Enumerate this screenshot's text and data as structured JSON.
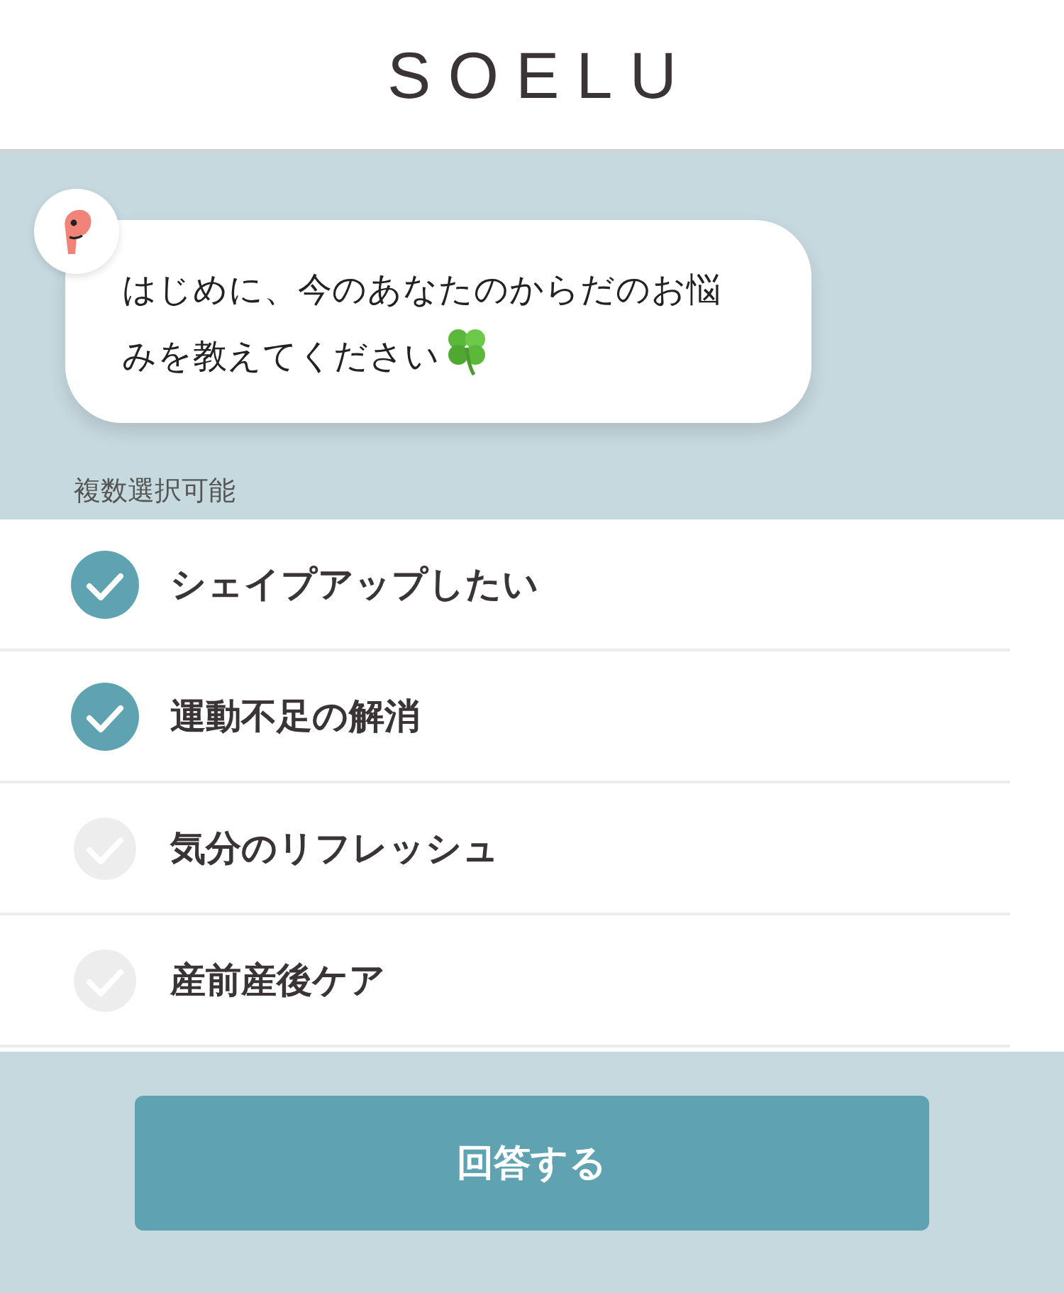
{
  "header": {
    "logo": "SOELU"
  },
  "message": {
    "text": "はじめに、今のあなたのからだのお悩みを教えてください"
  },
  "hint": "複数選択可能",
  "options": [
    {
      "label": "シェイプアップしたい",
      "checked": true
    },
    {
      "label": "運動不足の解消",
      "checked": true
    },
    {
      "label": "気分のリフレッシュ",
      "checked": false
    },
    {
      "label": "産前産後ケア",
      "checked": false
    }
  ],
  "submit": "回答する"
}
